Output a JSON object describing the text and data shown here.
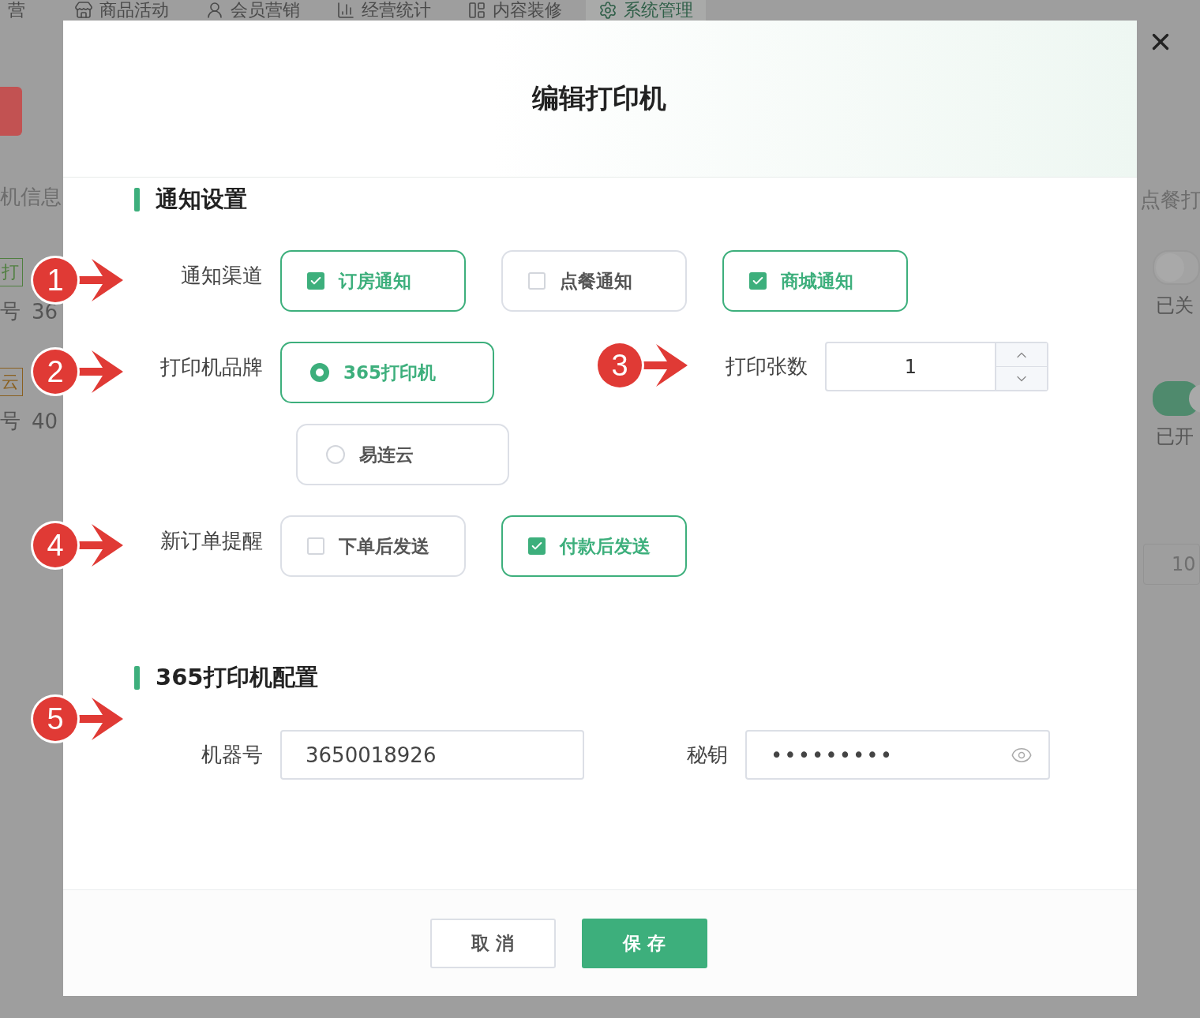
{
  "top_nav": [
    {
      "label": "营",
      "selected": false
    },
    {
      "label": "商品活动",
      "selected": false
    },
    {
      "label": "会员营销",
      "selected": false
    },
    {
      "label": "经营统计",
      "selected": false
    },
    {
      "label": "内容装修",
      "selected": false
    },
    {
      "label": "系统管理",
      "selected": true
    }
  ],
  "background_left": {
    "title": "机信息",
    "records": [
      {
        "tag": "打",
        "color": "#4f7f3f",
        "number_label": "号",
        "number": "36"
      },
      {
        "tag": "云",
        "color": "#8a6020",
        "number_label": "号",
        "number": "40"
      }
    ]
  },
  "background_right": {
    "title": "点餐打",
    "switches": [
      {
        "on": false,
        "status": "已关"
      },
      {
        "on": true,
        "status": "已开"
      }
    ],
    "page_size": "10"
  },
  "dialog": {
    "title": "编辑打印机",
    "sections": [
      {
        "title": "通知设置",
        "rows": [
          {
            "fields": [
              {
                "kind": "checkbox_group",
                "label": "通知渠道",
                "options": [
                  {
                    "label": "订房通知",
                    "checked": true
                  },
                  {
                    "label": "点餐通知",
                    "checked": false
                  },
                  {
                    "label": "商城通知",
                    "checked": true
                  }
                ]
              }
            ]
          },
          {
            "fields": [
              {
                "kind": "radio_group",
                "label": "打印机品牌",
                "options": [
                  {
                    "label": "365打印机",
                    "selected": true
                  },
                  {
                    "label": "易连云",
                    "selected": false
                  }
                ]
              },
              {
                "kind": "number",
                "label": "打印张数",
                "value": "1"
              }
            ]
          },
          {
            "fields": [
              {
                "kind": "checkbox_group",
                "label": "新订单提醒",
                "options": [
                  {
                    "label": "下单后发送",
                    "checked": false
                  },
                  {
                    "label": "付款后发送",
                    "checked": true
                  }
                ]
              }
            ]
          }
        ]
      },
      {
        "title": "365打印机配置",
        "rows": [
          {
            "fields": [
              {
                "kind": "text",
                "label": "机器号",
                "value": "3650018926"
              },
              {
                "kind": "password",
                "label": "秘钥",
                "value": "•••••••••"
              }
            ]
          }
        ]
      }
    ],
    "buttons": [
      {
        "label": "取 消",
        "primary": false
      },
      {
        "label": "保 存",
        "primary": true
      }
    ]
  },
  "annotations": [
    {
      "number": "1"
    },
    {
      "number": "2"
    },
    {
      "number": "3"
    },
    {
      "number": "4"
    },
    {
      "number": "5"
    }
  ]
}
